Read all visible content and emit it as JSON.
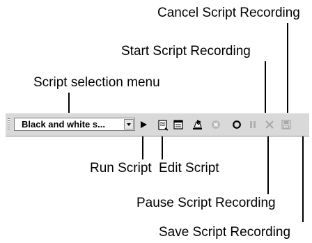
{
  "callouts": {
    "cancel": "Cancel Script Recording",
    "start": "Start Script Recording",
    "selection": "Script selection menu",
    "run": "Run Script",
    "edit": "Edit Script",
    "pause": "Pause Script Recording",
    "save": "Save Script Recording"
  },
  "toolbar": {
    "script_select_value": "Black and white s...",
    "icons": [
      "run-script-icon",
      "edit-script-icon",
      "script-list-icon",
      "script-action-icon",
      "stop-icon",
      "record-icon",
      "pause-icon",
      "cancel-icon",
      "save-icon"
    ]
  }
}
